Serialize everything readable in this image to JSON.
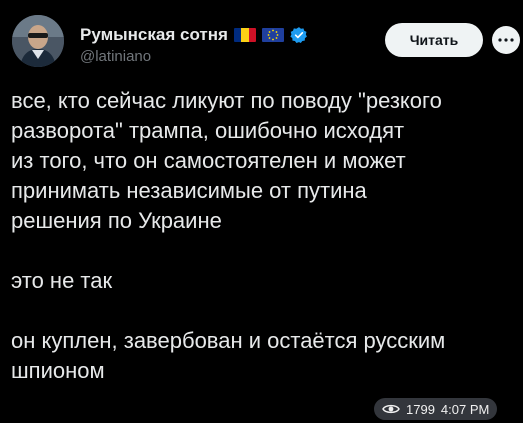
{
  "author": {
    "display_name": "Румынская сотня",
    "handle": "@latiniano",
    "avatar_icon": "user-avatar-photo",
    "badges": [
      "romania-flag-icon",
      "eu-flag-icon",
      "verified-badge-icon"
    ]
  },
  "actions": {
    "follow_label": "Читать",
    "more_icon": "more-dots-icon"
  },
  "tweet": {
    "lines": [
      "все, кто сейчас ликуют по поводу \"резкого",
      "разворота\" трампа, ошибочно исходят",
      "из того, что он самостоятелен и может",
      "принимать независимые от путина",
      "решения по Украине",
      "",
      "это не так",
      "",
      "он куплен, завербован и остаётся русским",
      "шпионом"
    ]
  },
  "meta": {
    "views_icon": "eye-icon",
    "views": "1799",
    "time": "4:07 PM"
  },
  "colors": {
    "background": "#000000",
    "text": "#e7e9ea",
    "secondary": "#71767b",
    "verified": "#1d9bf0",
    "button_bg": "#eff3f4",
    "button_text": "#0f1419"
  }
}
